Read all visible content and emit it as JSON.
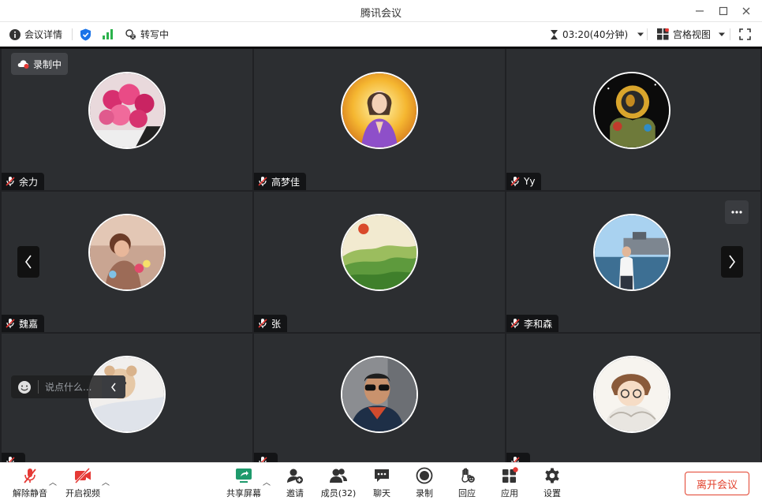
{
  "window": {
    "title": "腾讯会议"
  },
  "infobar": {
    "meeting_details": "会议详情",
    "transcribing": "转写中",
    "timer": "03:20(40分钟)",
    "view_mode": "宫格视图"
  },
  "recording_badge": "录制中",
  "participants": [
    {
      "name": "余力",
      "avatar": "pink-roses"
    },
    {
      "name": "高梦佳",
      "avatar": "golden-portrait"
    },
    {
      "name": "Yy",
      "avatar": "gold-astronaut"
    },
    {
      "name": "魏嘉",
      "avatar": "child-photo"
    },
    {
      "name": "张",
      "avatar": "green-hills-sunset"
    },
    {
      "name": "李和森",
      "avatar": "man-at-harbor"
    },
    {
      "name": "",
      "avatar": "teddy-bear"
    },
    {
      "name": "",
      "avatar": "man-sunglasses"
    },
    {
      "name": "",
      "avatar": "anime-character"
    }
  ],
  "chat": {
    "placeholder": "说点什么..."
  },
  "toolbar": {
    "unmute": "解除静音",
    "start_video": "开启视频",
    "share_screen": "共享屏幕",
    "invite": "邀请",
    "members": "成员(32)",
    "chat": "聊天",
    "record": "录制",
    "reactions": "回应",
    "apps": "应用",
    "settings": "设置",
    "leave": "离开会议"
  },
  "colors": {
    "accent": "#1A73E8",
    "leave_red": "#E2422E",
    "tile_bg": "#2C2E31",
    "muted_red": "#E53935",
    "signal_green": "#2BB24C"
  }
}
